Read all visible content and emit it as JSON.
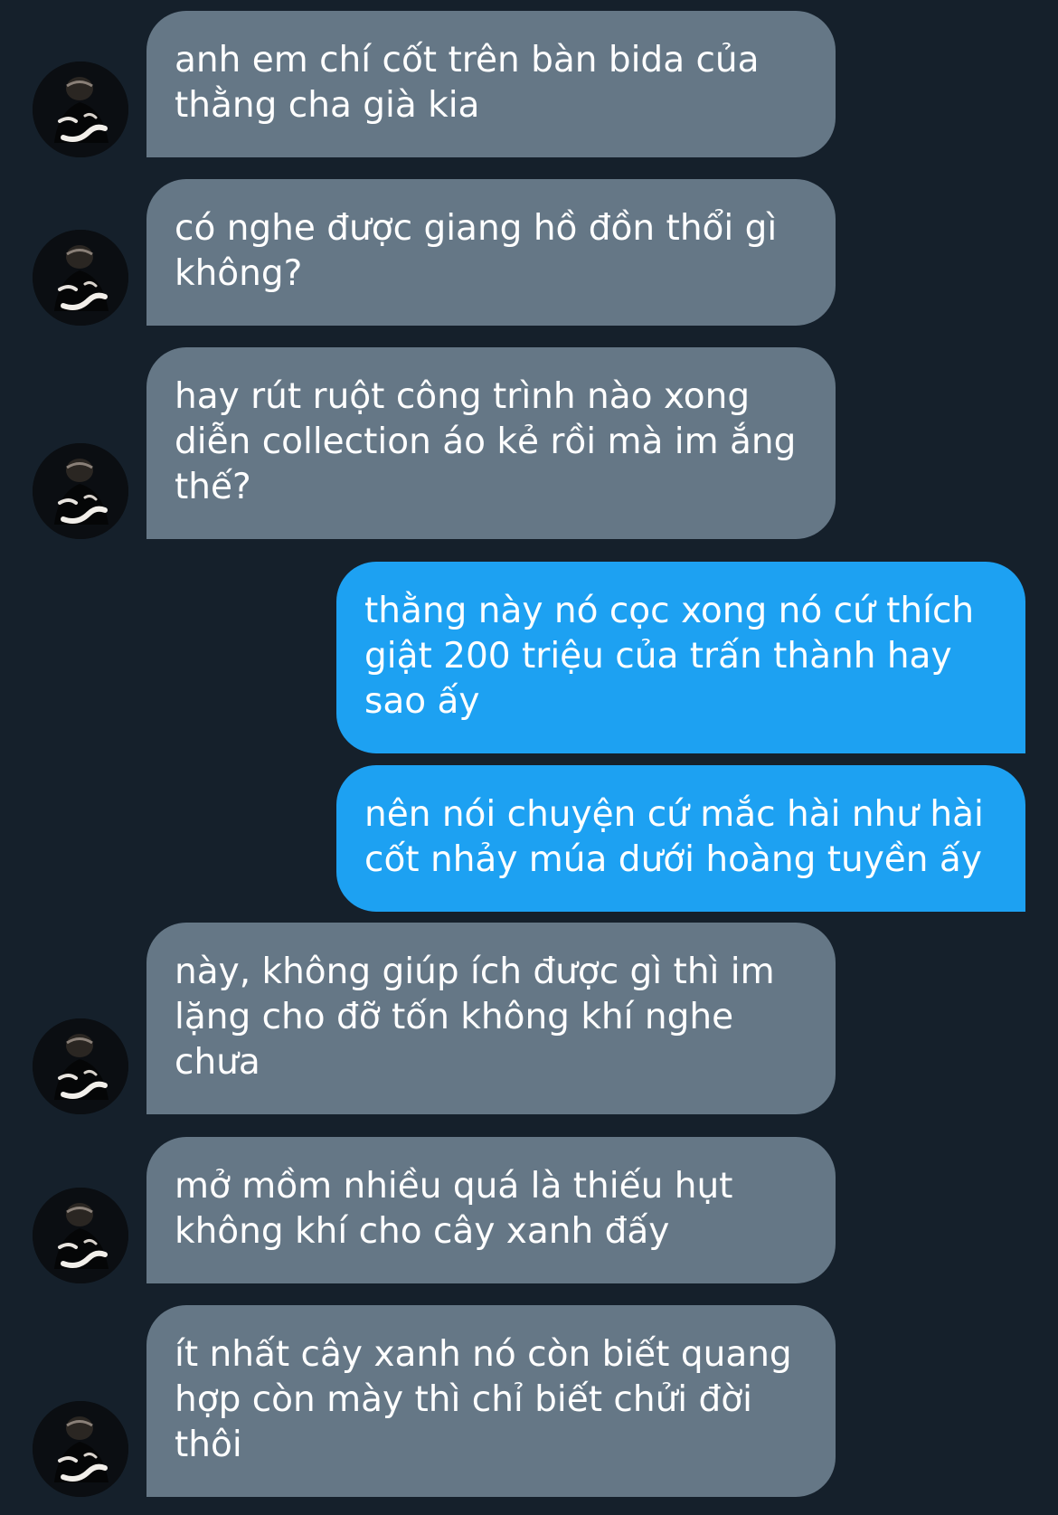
{
  "colors": {
    "background": "#15202b",
    "incoming_bubble": "#657786",
    "outgoing_bubble": "#1da1f2",
    "text": "#ffffff"
  },
  "avatar_icon": "user-avatar-icon",
  "messages": [
    {
      "direction": "incoming",
      "text": "anh em chí cốt trên bàn bida của\nthằng cha già kia"
    },
    {
      "direction": "incoming",
      "text": "có nghe được giang hồ đồn thổi gì\nkhông?"
    },
    {
      "direction": "incoming",
      "text": "hay rút ruột công trình nào xong\ndiễn collection áo kẻ rồi mà im ắng\nthế?"
    },
    {
      "direction": "outgoing",
      "text": "thằng này nó cọc xong nó cứ thích\ngiật 200 triệu của trấn thành hay\nsao ấy"
    },
    {
      "direction": "outgoing",
      "text": "nên nói chuyện cứ mắc hài như hài\ncốt nhảy múa dưới hoàng tuyền ấy"
    },
    {
      "direction": "incoming",
      "text": "này, không giúp ích được gì thì im\nlặng cho đỡ tốn không khí nghe\nchưa"
    },
    {
      "direction": "incoming",
      "text": "mở mồm nhiều quá là thiếu hụt\nkhông khí cho cây xanh đấy"
    },
    {
      "direction": "incoming",
      "text": "ít nhất cây xanh nó còn biết quang\nhợp còn mày thì chỉ biết chửi đời\nthôi"
    }
  ]
}
